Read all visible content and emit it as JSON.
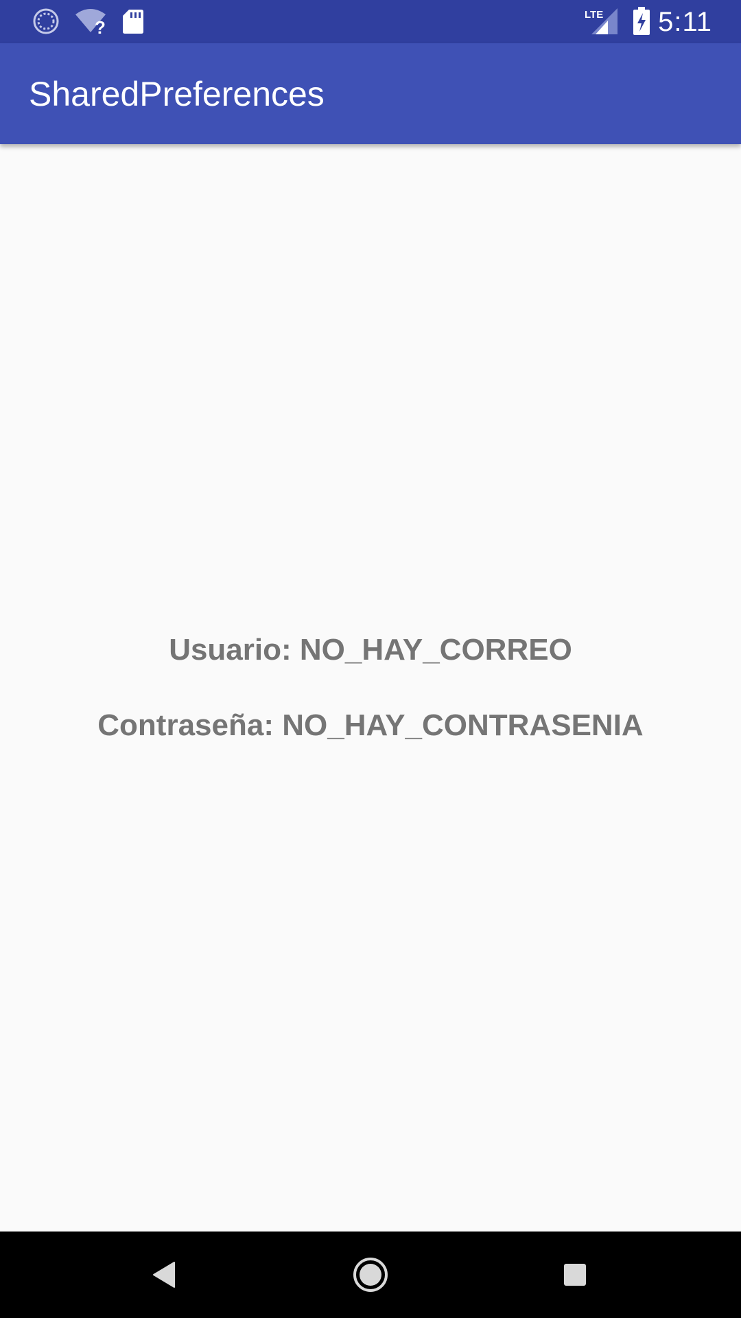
{
  "status_bar": {
    "time": "5:11",
    "network_label": "LTE",
    "icons": [
      "sync-icon",
      "wifi-unknown-icon",
      "sd-card-icon",
      "lte-signal-icon",
      "battery-charging-icon"
    ],
    "background_color": "#303f9f"
  },
  "app_bar": {
    "title": "SharedPreferences",
    "background_color": "#3f51b5"
  },
  "content": {
    "user_line": "Usuario: NO_HAY_CORREO",
    "password_line": "Contraseña: NO_HAY_CONTRASENIA",
    "text_color": "#757575"
  },
  "nav_bar": {
    "buttons": [
      "back-icon",
      "home-icon",
      "recents-icon"
    ]
  }
}
